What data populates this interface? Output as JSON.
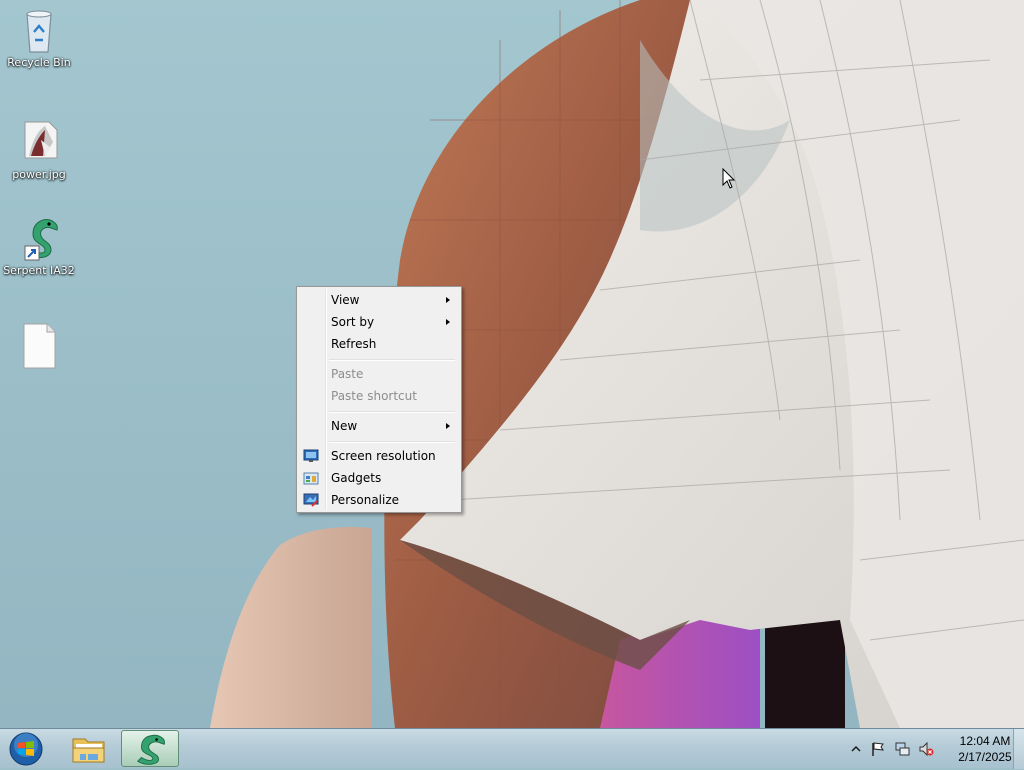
{
  "desktop": {
    "icons": [
      {
        "label": "Recycle Bin",
        "icon": "recycle-bin-icon"
      },
      {
        "label": "power.jpg",
        "icon": "image-file-icon"
      },
      {
        "label": "Serpent IA32",
        "icon": "serpent-shortcut-icon"
      },
      {
        "label": "",
        "icon": "blank-file-icon"
      }
    ]
  },
  "context_menu": {
    "items": [
      {
        "label": "View",
        "submenu": true,
        "enabled": true
      },
      {
        "label": "Sort by",
        "submenu": true,
        "enabled": true
      },
      {
        "label": "Refresh",
        "submenu": false,
        "enabled": true
      },
      {
        "label": "Paste",
        "submenu": false,
        "enabled": false
      },
      {
        "label": "Paste shortcut",
        "submenu": false,
        "enabled": false
      },
      {
        "label": "New",
        "submenu": true,
        "enabled": true
      },
      {
        "label": "Screen resolution",
        "submenu": false,
        "enabled": true,
        "icon": "screen-resolution-icon"
      },
      {
        "label": "Gadgets",
        "submenu": false,
        "enabled": true,
        "icon": "gadgets-icon"
      },
      {
        "label": "Personalize",
        "submenu": false,
        "enabled": true,
        "icon": "personalize-icon"
      }
    ]
  },
  "taskbar": {
    "start_icon": "windows-start-orb-icon",
    "pinned": [
      {
        "name": "Windows Explorer",
        "icon": "folder-explorer-icon",
        "active": false
      },
      {
        "name": "Serpent IA32",
        "icon": "serpent-icon",
        "active": true
      }
    ],
    "tray": {
      "icons": [
        "show-hidden-icons-chevron-icon",
        "action-center-flag-icon",
        "network-icon",
        "volume-muted-icon"
      ],
      "time": "12:04 AM",
      "date": "2/17/2025"
    }
  },
  "colors": {
    "sky": "#9dc0c9",
    "building_copper": "#a5664b",
    "building_purple": "#b45ab6",
    "panels_white": "#e8e4e0",
    "menu_bg": "#f0f0f0",
    "disabled_text": "#8d8d8d"
  }
}
